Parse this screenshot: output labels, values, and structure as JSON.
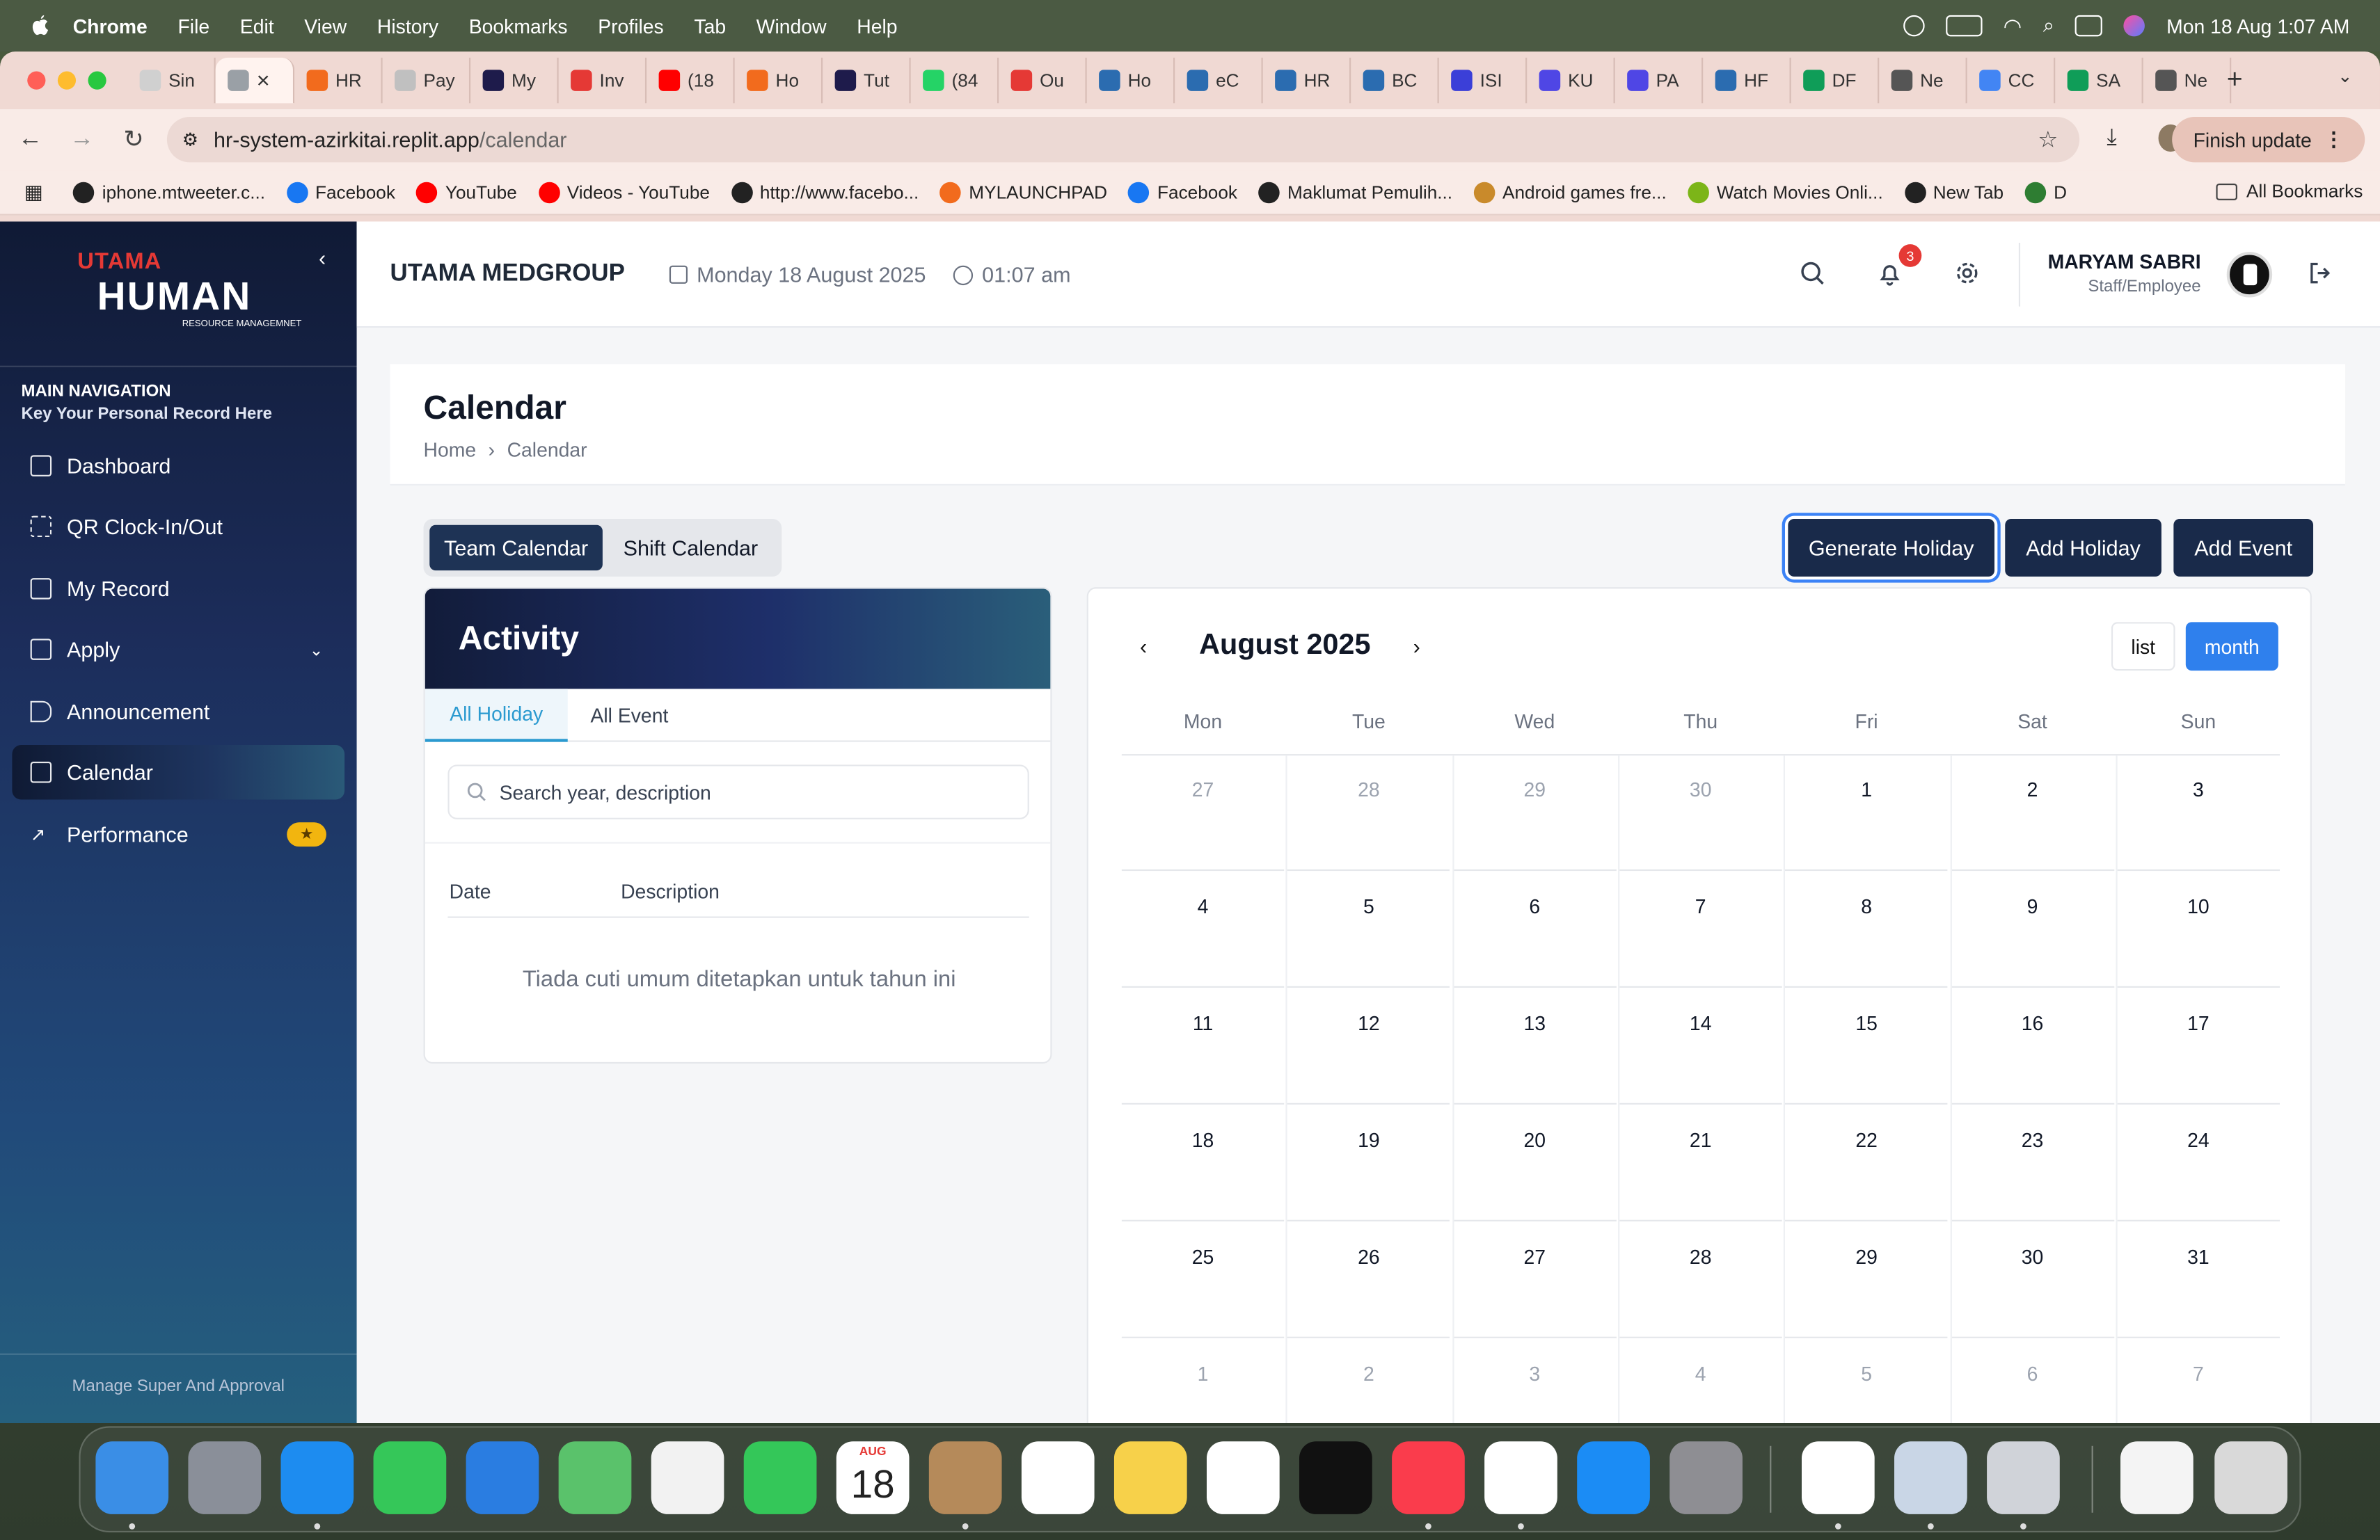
{
  "menubar": {
    "app": "Chrome",
    "items": [
      "File",
      "Edit",
      "View",
      "History",
      "Bookmarks",
      "Profiles",
      "Tab",
      "Window",
      "Help"
    ],
    "clock": "Mon 18 Aug  1:07 AM"
  },
  "browser": {
    "tabs": [
      {
        "label": "Sin",
        "color": "#d0d0d0"
      },
      {
        "label": "",
        "color": "#9aa0a6",
        "active": true
      },
      {
        "label": "HR",
        "color": "#f26b1d"
      },
      {
        "label": "Pay",
        "color": "#c0c0c0"
      },
      {
        "label": "My",
        "color": "#1e1b4b"
      },
      {
        "label": "Inv",
        "color": "#e53935"
      },
      {
        "label": "(18",
        "color": "#ff0000"
      },
      {
        "label": "Ho",
        "color": "#f26b1d"
      },
      {
        "label": "Tut",
        "color": "#1e1b4b"
      },
      {
        "label": "(84",
        "color": "#25d366"
      },
      {
        "label": "Ou",
        "color": "#e53935"
      },
      {
        "label": "Ho",
        "color": "#2b6cb0"
      },
      {
        "label": "eC",
        "color": "#2b6cb0"
      },
      {
        "label": "HR",
        "color": "#2b6cb0"
      },
      {
        "label": "BC",
        "color": "#2b6cb0"
      },
      {
        "label": "ISI",
        "color": "#3b3fd8"
      },
      {
        "label": "KU",
        "color": "#4f46e5"
      },
      {
        "label": "PA",
        "color": "#4f46e5"
      },
      {
        "label": "HF",
        "color": "#2b6cb0"
      },
      {
        "label": "DF",
        "color": "#0f9d58"
      },
      {
        "label": "Ne",
        "color": "#555555"
      },
      {
        "label": "CC",
        "color": "#4285f4"
      },
      {
        "label": "SA",
        "color": "#0f9d58"
      },
      {
        "label": "Ne",
        "color": "#555555"
      }
    ],
    "url_host": "hr-system-azirkitai.replit.app",
    "url_path": "/calendar",
    "finish_update": "Finish update",
    "bookmarks": [
      {
        "label": "iphone.mtweeter.c...",
        "color": "#222222"
      },
      {
        "label": "Facebook",
        "color": "#1877f2"
      },
      {
        "label": "YouTube",
        "color": "#ff0000"
      },
      {
        "label": "Videos - YouTube",
        "color": "#ff0000"
      },
      {
        "label": "http://www.facebo...",
        "color": "#222222"
      },
      {
        "label": "MYLAUNCHPAD",
        "color": "#f26b1d"
      },
      {
        "label": "Facebook",
        "color": "#1877f2"
      },
      {
        "label": "Maklumat Pemulih...",
        "color": "#222222"
      },
      {
        "label": "Android games fre...",
        "color": "#c98a2b"
      },
      {
        "label": "Watch Movies Onli...",
        "color": "#7cb518"
      },
      {
        "label": "New Tab",
        "color": "#222222"
      },
      {
        "label": "D",
        "color": "#2e7d32"
      }
    ],
    "all_bookmarks": "All Bookmarks"
  },
  "sidebar": {
    "logo_top": "UTAMA",
    "logo_main": "HUMAN",
    "logo_sub": "RESOURCE MANAGEMNET",
    "section_title": "MAIN NAVIGATION",
    "section_sub": "Key Your Personal Record Here",
    "items": [
      {
        "label": "Dashboard"
      },
      {
        "label": "QR Clock-In/Out"
      },
      {
        "label": "My Record"
      },
      {
        "label": "Apply"
      },
      {
        "label": "Announcement"
      },
      {
        "label": "Calendar"
      },
      {
        "label": "Performance"
      }
    ],
    "footer": "Manage Super And Approval"
  },
  "header": {
    "company": "UTAMA MEDGROUP",
    "date": "Monday 18 August 2025",
    "time": "01:07 am",
    "notifications": "3",
    "user_name": "MARYAM SABRI",
    "user_role": "Staff/Employee"
  },
  "content": {
    "title": "Calendar",
    "breadcrumb_home": "Home",
    "breadcrumb_current": "Calendar",
    "tab_team": "Team Calendar",
    "tab_shift": "Shift Calendar",
    "btn_generate": "Generate Holiday",
    "btn_add_holiday": "Add Holiday",
    "btn_add_event": "Add Event"
  },
  "activity": {
    "title": "Activity",
    "tab_holiday": "All Holiday",
    "tab_event": "All Event",
    "search_placeholder": "Search year, description",
    "col_date": "Date",
    "col_description": "Description",
    "empty_message": "Tiada cuti umum ditetapkan untuk tahun ini"
  },
  "calendar": {
    "title": "August 2025",
    "view_list": "list",
    "view_month": "month",
    "weekdays": [
      "Mon",
      "Tue",
      "Wed",
      "Thu",
      "Fri",
      "Sat",
      "Sun"
    ],
    "weeks": [
      [
        "27",
        "28",
        "29",
        "30",
        "1",
        "2",
        "3"
      ],
      [
        "4",
        "5",
        "6",
        "7",
        "8",
        "9",
        "10"
      ],
      [
        "11",
        "12",
        "13",
        "14",
        "15",
        "16",
        "17"
      ],
      [
        "18",
        "19",
        "20",
        "21",
        "22",
        "23",
        "24"
      ],
      [
        "25",
        "26",
        "27",
        "28",
        "29",
        "30",
        "31"
      ],
      [
        "1",
        "2",
        "3",
        "4",
        "5",
        "6",
        "7"
      ]
    ],
    "muted": [
      [
        true,
        true,
        true,
        true,
        false,
        false,
        false
      ],
      [
        false,
        false,
        false,
        false,
        false,
        false,
        false
      ],
      [
        false,
        false,
        false,
        false,
        false,
        false,
        false
      ],
      [
        false,
        false,
        false,
        false,
        false,
        false,
        false
      ],
      [
        false,
        false,
        false,
        false,
        false,
        false,
        false
      ],
      [
        true,
        true,
        true,
        true,
        true,
        true,
        true
      ]
    ]
  },
  "dock": {
    "apps": [
      {
        "name": "finder-icon",
        "color": "#3a8ee6"
      },
      {
        "name": "launchpad-icon",
        "color": "#8a8f99"
      },
      {
        "name": "safari-icon",
        "color": "#1d8cf0"
      },
      {
        "name": "messages-icon",
        "color": "#35c759"
      },
      {
        "name": "mail-icon",
        "color": "#2a7de1"
      },
      {
        "name": "maps-icon",
        "color": "#5ac26b"
      },
      {
        "name": "photos-icon",
        "color": "#f2f2f2"
      },
      {
        "name": "facetime-icon",
        "color": "#34c759"
      },
      {
        "name": "calendar-app-icon",
        "color": "#ffffff"
      },
      {
        "name": "contacts-icon",
        "color": "#b58a5a"
      },
      {
        "name": "reminders-icon",
        "color": "#ffffff"
      },
      {
        "name": "notes-icon",
        "color": "#f7d14a"
      },
      {
        "name": "freeform-icon",
        "color": "#ffffff"
      },
      {
        "name": "apple-tv-icon",
        "color": "#111111"
      },
      {
        "name": "music-icon",
        "color": "#fa3c4c"
      },
      {
        "name": "chrome-icon",
        "color": "#ffffff"
      },
      {
        "name": "app-store-icon",
        "color": "#1b8cf5"
      },
      {
        "name": "system-settings-icon",
        "color": "#8e8e93"
      },
      {
        "name": "word-icon",
        "color": "#ffffff"
      },
      {
        "name": "preview-icon",
        "color": "#c9d6e6"
      },
      {
        "name": "iphone-mirroring-icon",
        "color": "#d0d3d9"
      },
      {
        "name": "downloads-stack-icon",
        "color": "#f4f4f4"
      },
      {
        "name": "trash-icon",
        "color": "#d9d9d9"
      }
    ],
    "calendar_month": "AUG",
    "calendar_day": "18"
  }
}
